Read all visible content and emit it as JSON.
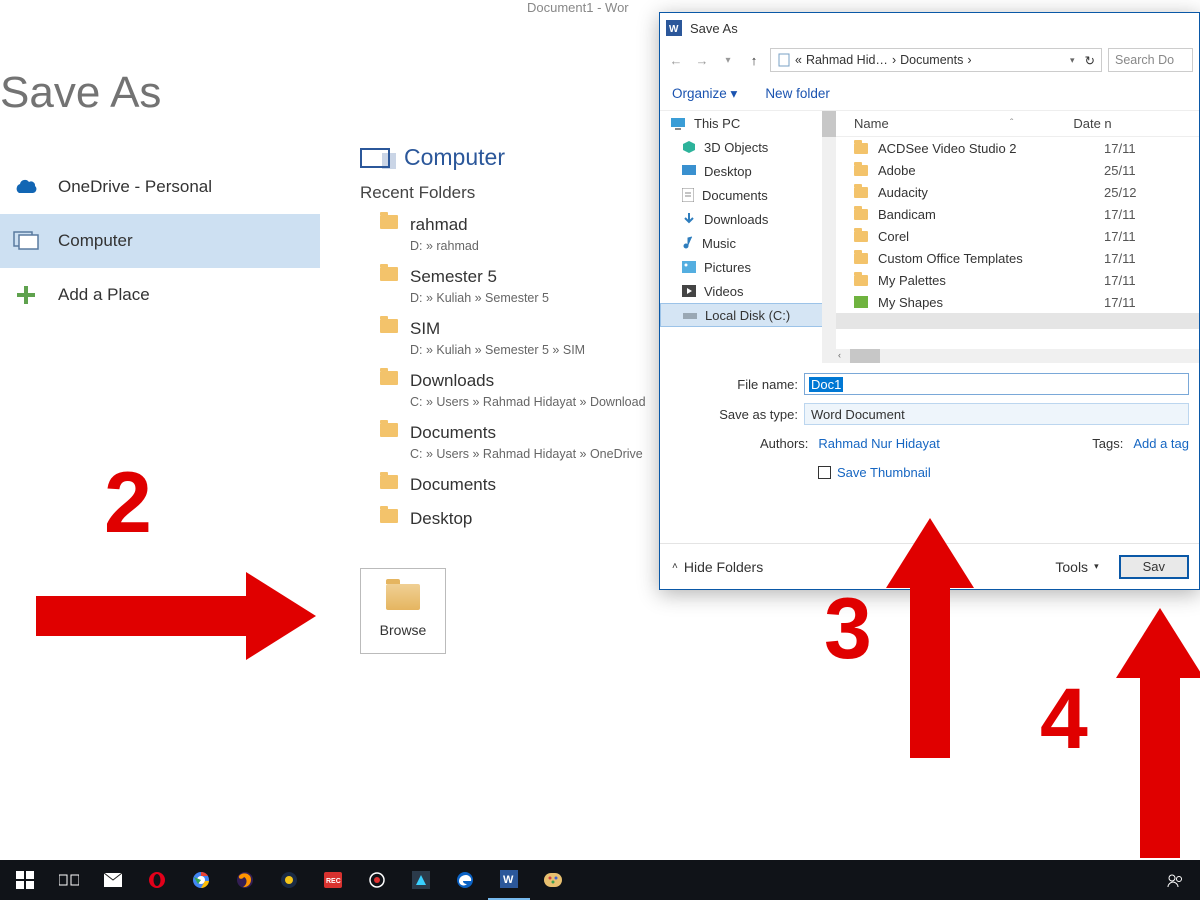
{
  "app_title": "Document1 - Wor",
  "page_heading": "Save As",
  "sidebar": {
    "items": [
      {
        "label": "OneDrive - Personal",
        "icon": "onedrive-icon"
      },
      {
        "label": "Computer",
        "icon": "computer-icon"
      },
      {
        "label": "Add a Place",
        "icon": "add-icon"
      }
    ]
  },
  "main": {
    "heading": "Computer",
    "recent_label": "Recent Folders",
    "folders": [
      {
        "name": "rahmad",
        "path": "D: » rahmad"
      },
      {
        "name": "Semester 5",
        "path": "D: » Kuliah » Semester 5"
      },
      {
        "name": "SIM",
        "path": "D: » Kuliah » Semester 5 » SIM"
      },
      {
        "name": "Downloads",
        "path": "C: » Users » Rahmad Hidayat » Download"
      },
      {
        "name": "Documents",
        "path": "C: » Users » Rahmad Hidayat » OneDrive "
      },
      {
        "name": "Documents",
        "path": ""
      },
      {
        "name": "Desktop",
        "path": ""
      }
    ],
    "browse_label": "Browse"
  },
  "dialog": {
    "title": "Save As",
    "breadcrumb": {
      "prefix": "«",
      "part1": "Rahmad Hid…",
      "sep": "›",
      "part2": "Documents",
      "tail": "›"
    },
    "search_placeholder": "Search Do",
    "toolbar": {
      "organize": "Organize ▾",
      "newfolder": "New folder"
    },
    "tree": [
      {
        "label": "This PC",
        "icon": "pc"
      },
      {
        "label": "3D Objects",
        "icon": "3d"
      },
      {
        "label": "Desktop",
        "icon": "desktop"
      },
      {
        "label": "Documents",
        "icon": "doc"
      },
      {
        "label": "Downloads",
        "icon": "dl"
      },
      {
        "label": "Music",
        "icon": "music"
      },
      {
        "label": "Pictures",
        "icon": "pic"
      },
      {
        "label": "Videos",
        "icon": "vid"
      },
      {
        "label": "Local Disk (C:)",
        "icon": "disk"
      }
    ],
    "files_header": {
      "name": "Name",
      "date": "Date n"
    },
    "files": [
      {
        "name": "ACDSee Video Studio 2",
        "date": "17/11"
      },
      {
        "name": "Adobe",
        "date": "25/11"
      },
      {
        "name": "Audacity",
        "date": "25/12"
      },
      {
        "name": "Bandicam",
        "date": "17/11"
      },
      {
        "name": "Corel",
        "date": "17/11"
      },
      {
        "name": "Custom Office Templates",
        "date": "17/11"
      },
      {
        "name": "My Palettes",
        "date": "17/11"
      },
      {
        "name": "My Shapes",
        "date": "17/11"
      }
    ],
    "filename_label": "File name:",
    "filename_value": "Doc1",
    "saveastype_label": "Save as type:",
    "saveastype_value": "Word Document",
    "authors_label": "Authors:",
    "authors_value": "Rahmad Nur Hidayat",
    "tags_label": "Tags:",
    "tags_value": "Add a tag",
    "save_thumbnail": "Save Thumbnail",
    "hide_folders": "Hide Folders",
    "tools": "Tools",
    "save": "Sav"
  },
  "annotations": {
    "n2": "2",
    "n3": "3",
    "n4": "4"
  }
}
